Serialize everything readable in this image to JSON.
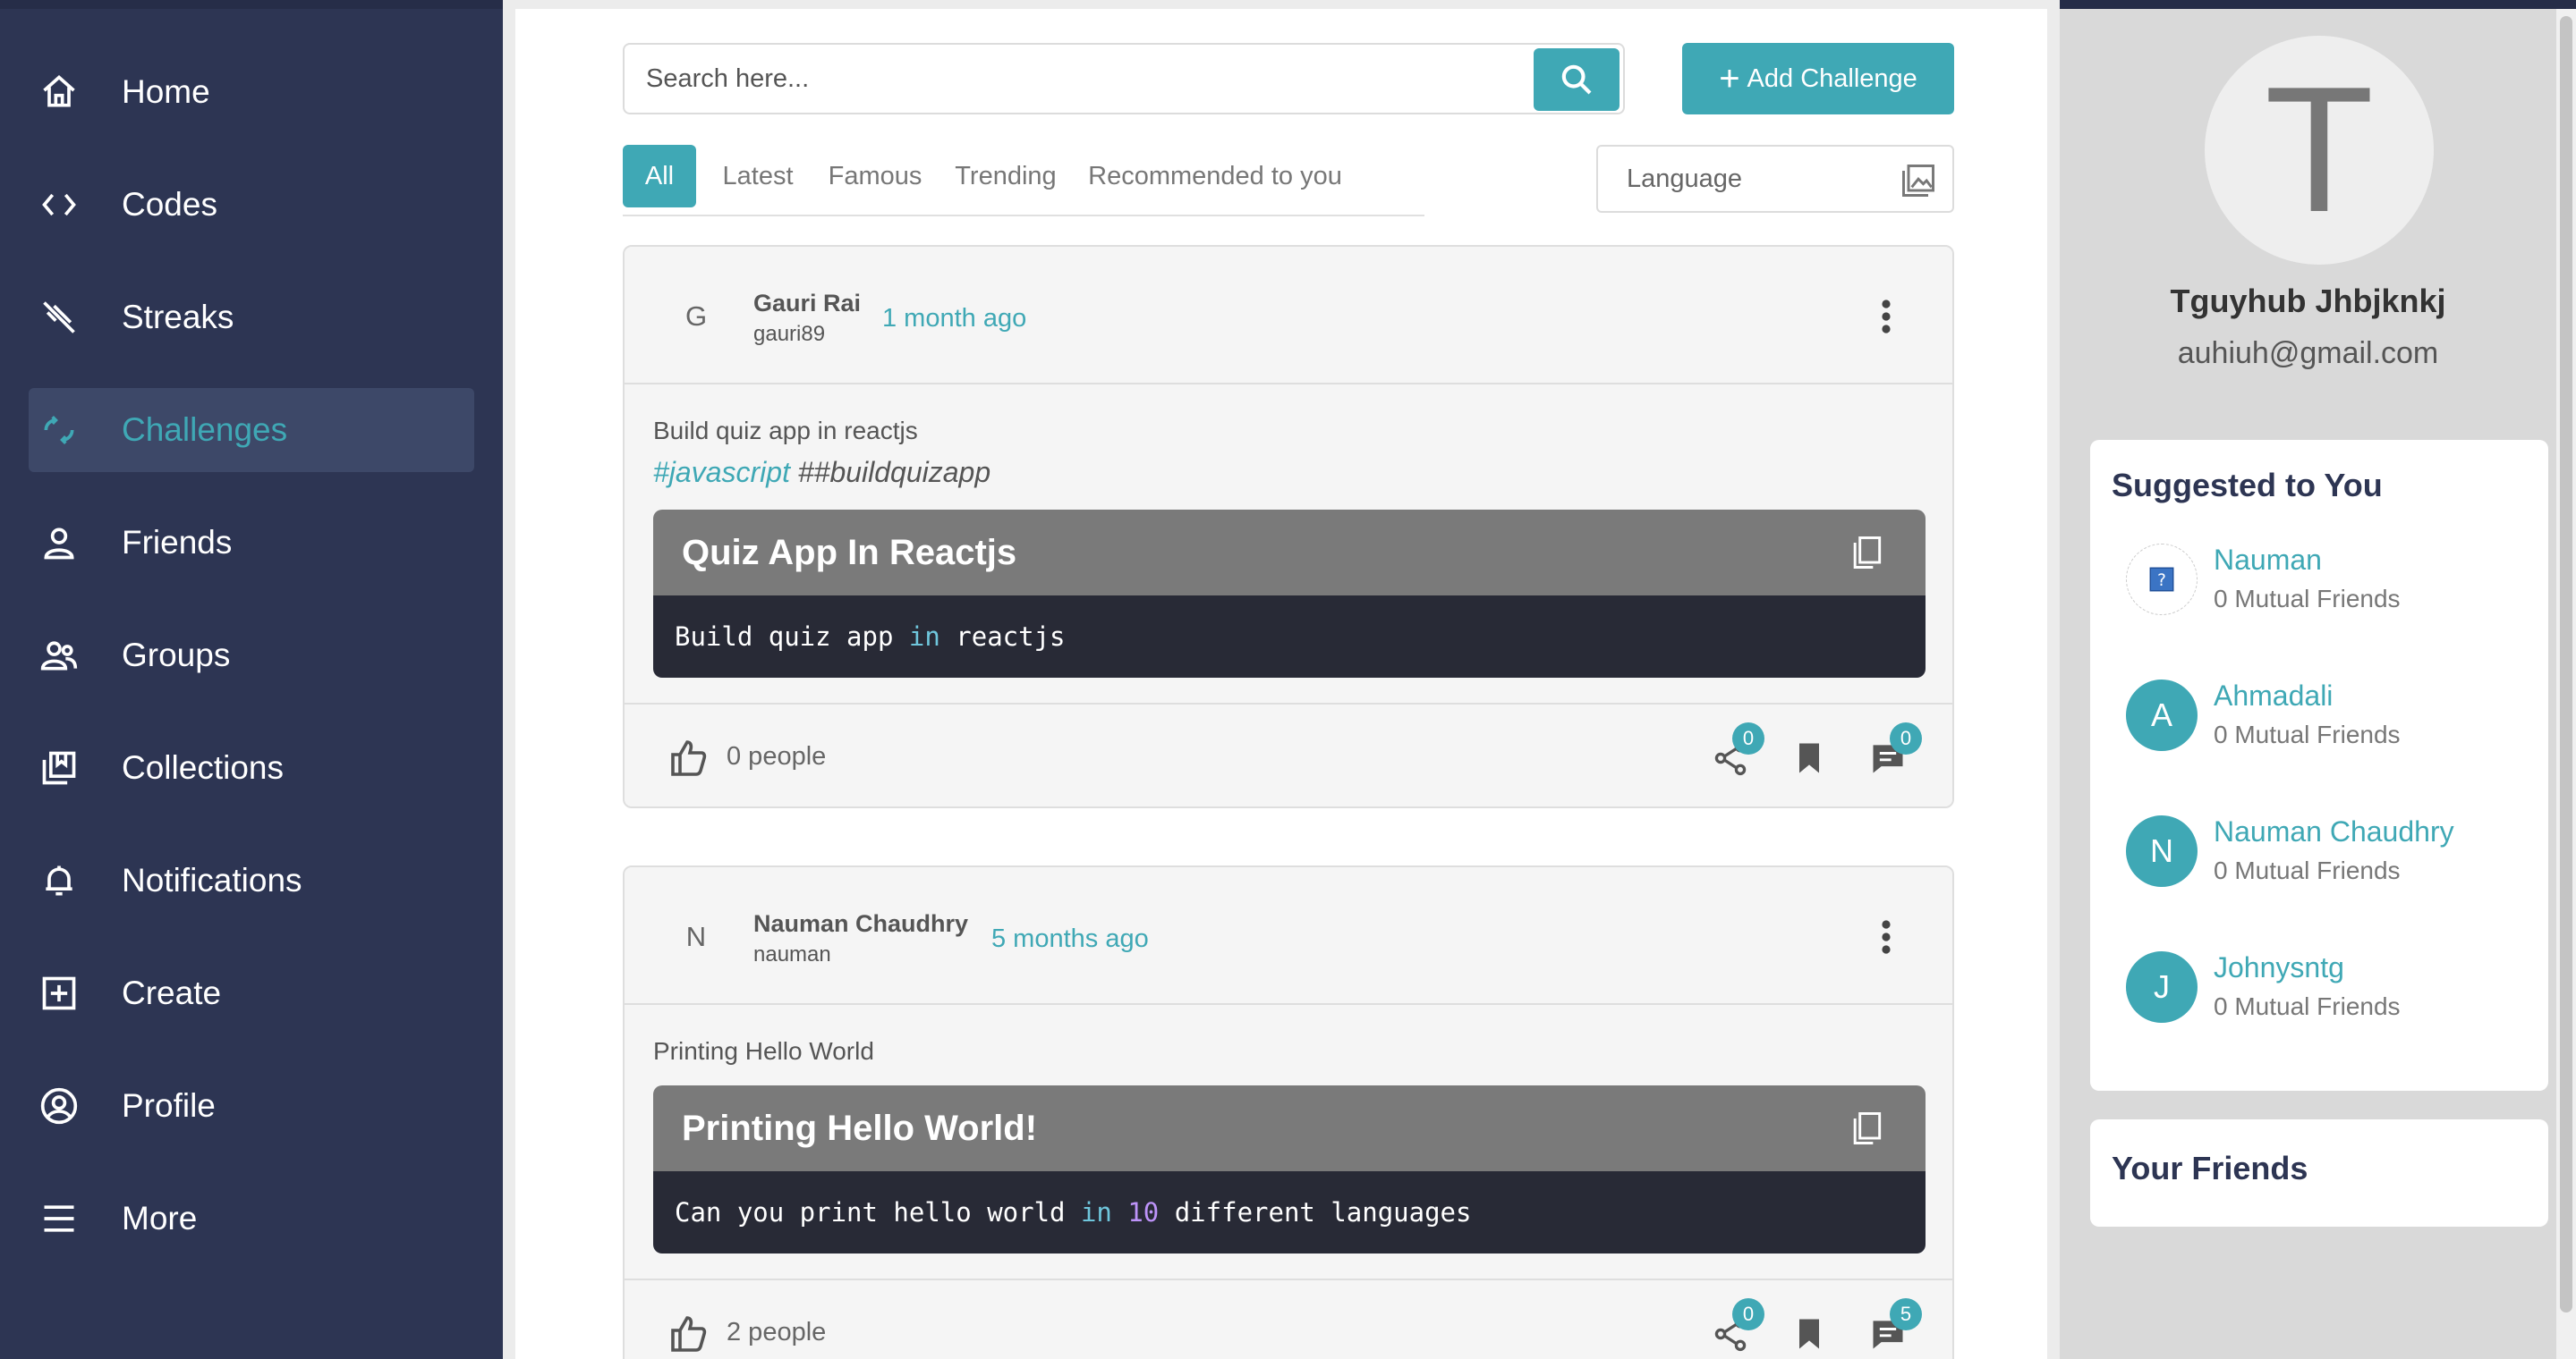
{
  "sidebar": {
    "items": [
      {
        "label": "Home",
        "icon": "home-icon"
      },
      {
        "label": "Codes",
        "icon": "code-icon"
      },
      {
        "label": "Streaks",
        "icon": "streak-icon"
      },
      {
        "label": "Challenges",
        "icon": "challenge-icon",
        "active": true
      },
      {
        "label": "Friends",
        "icon": "person-icon"
      },
      {
        "label": "Groups",
        "icon": "group-icon"
      },
      {
        "label": "Collections",
        "icon": "collections-icon"
      },
      {
        "label": "Notifications",
        "icon": "bell-icon"
      },
      {
        "label": "Create",
        "icon": "plus-square-icon"
      },
      {
        "label": "Profile",
        "icon": "user-circle-icon"
      },
      {
        "label": "More",
        "icon": "menu-icon"
      }
    ]
  },
  "search": {
    "placeholder": "Search here..."
  },
  "add_challenge_label": "Add Challenge",
  "tabs": [
    "All",
    "Latest",
    "Famous",
    "Trending",
    "Recommended to you"
  ],
  "language": {
    "placeholder": "Language"
  },
  "posts": [
    {
      "avatar_letter": "G",
      "author": "Gauri Rai",
      "handle": "gauri89",
      "time": "1 month ago",
      "description": "Build quiz app in reactjs",
      "tags": [
        "#javascript",
        "##buildquizapp"
      ],
      "code_title": "Quiz App In Reactjs",
      "code": {
        "pre": "Build quiz app ",
        "kw": "in",
        "post": " reactjs"
      },
      "likes": "0 people",
      "shares": "0",
      "comments": "0"
    },
    {
      "avatar_letter": "N",
      "author": "Nauman Chaudhry",
      "handle": "nauman",
      "time": "5 months ago",
      "description": "Printing Hello World",
      "code_title": "Printing Hello World!",
      "code": {
        "pre": "Can you print hello world ",
        "kw": "in",
        "num": "10",
        "post": " different languages"
      },
      "likes": "2 people",
      "shares": "0",
      "comments": "5"
    }
  ],
  "profile": {
    "initial": "T",
    "name": "Tguyhub Jhbjknkj",
    "email": "auhiuh@gmail.com"
  },
  "suggested": {
    "title": "Suggested to You",
    "users": [
      {
        "name": "Nauman",
        "mutual": "0 Mutual Friends",
        "initial": "?"
      },
      {
        "name": "Ahmadali",
        "mutual": "0 Mutual Friends",
        "initial": "A"
      },
      {
        "name": "Nauman Chaudhry",
        "mutual": "0 Mutual Friends",
        "initial": "N"
      },
      {
        "name": "Johnysntg",
        "mutual": "0 Mutual Friends",
        "initial": "J"
      }
    ]
  },
  "friends": {
    "title": "Your Friends"
  },
  "colors": {
    "sidebar": "#2d3553",
    "accent": "#3fa8b5",
    "code_bg": "#282a36",
    "code_title_bg": "#7a7a7a"
  }
}
